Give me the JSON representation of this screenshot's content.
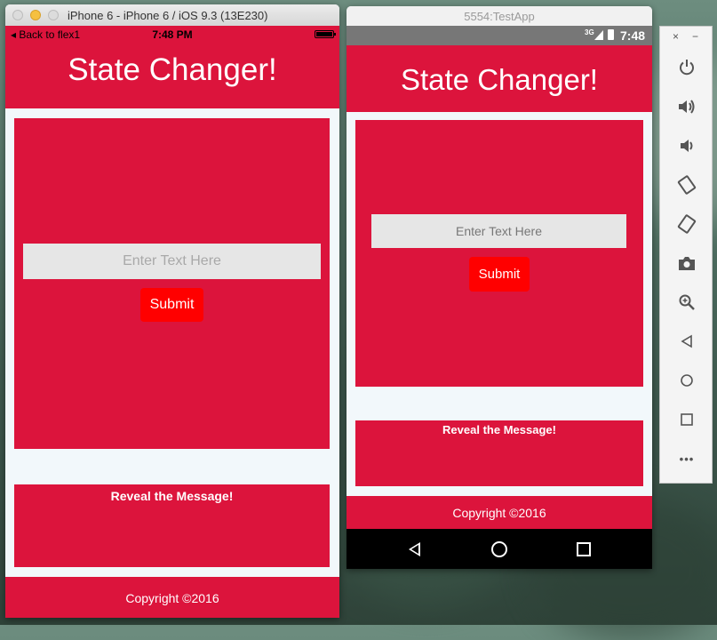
{
  "ios_simulator": {
    "window_title": "iPhone 6 - iPhone 6 / iOS 9.3 (13E230)",
    "status": {
      "back_label": "◂ Back to flex1",
      "time": "7:48 PM"
    },
    "app": {
      "header_title": "State Changer!",
      "input_placeholder": "Enter Text Here",
      "submit_label": "Submit",
      "reveal_label": "Reveal the Message!",
      "copyright": "Copyright ©2016"
    }
  },
  "android_emulator": {
    "window_title": "5554:TestApp",
    "status": {
      "network": "3G",
      "time": "7:48"
    },
    "app": {
      "header_title": "State Changer!",
      "input_placeholder": "Enter Text Here",
      "submit_label": "Submit",
      "reveal_label": "Reveal the Message!",
      "copyright": "Copyright ©2016"
    },
    "nav_buttons": [
      "back-icon",
      "home-icon",
      "recents-icon"
    ]
  },
  "emulator_toolbar": {
    "close_glyph": "×",
    "minimize_glyph": "−",
    "more_glyph": "•••",
    "buttons": [
      "power-icon",
      "volume-up-icon",
      "volume-down-icon",
      "rotate-left-icon",
      "rotate-right-icon",
      "camera-icon",
      "zoom-icon",
      "back-icon",
      "home-icon",
      "overview-icon",
      "more-icon"
    ]
  },
  "colors": {
    "app_primary": "#dc143c",
    "button_red": "#ff0000",
    "input_gray": "#e6e6e6",
    "screen_background": "#f2f8fb"
  }
}
